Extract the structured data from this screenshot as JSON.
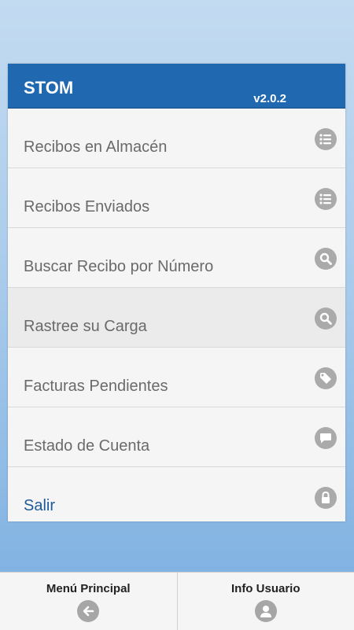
{
  "header": {
    "title": "STOM",
    "version": "v2.0.2"
  },
  "menu": [
    {
      "label": "Recibos en Almacén",
      "icon": "list-icon"
    },
    {
      "label": "Recibos Enviados",
      "icon": "list-icon"
    },
    {
      "label": "Buscar Recibo por Número",
      "icon": "search-icon"
    },
    {
      "label": "Rastree su Carga",
      "icon": "search-icon"
    },
    {
      "label": "Facturas Pendientes",
      "icon": "tag-icon"
    },
    {
      "label": "Estado de Cuenta",
      "icon": "chat-icon"
    },
    {
      "label": "Salir",
      "icon": "lock-icon"
    }
  ],
  "footer": {
    "main_menu_label": "Menú Principal",
    "main_menu_icon": "arrow-left-icon",
    "user_info_label": "Info Usuario",
    "user_info_icon": "user-icon"
  },
  "colors": {
    "header": "#2068b0",
    "icon_gray": "#aaaaaa",
    "exit_text": "#1e5a9a",
    "menu_text": "#6a6a6a"
  }
}
